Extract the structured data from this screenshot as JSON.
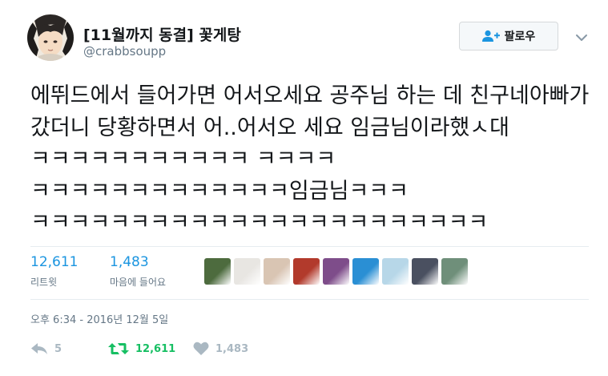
{
  "user": {
    "display_name": "[11월까지 동결] 꽃게탕",
    "handle": "@crabbsoupp",
    "avatar_icon": "anime-profile-avatar"
  },
  "follow_button": {
    "label": "팔로우",
    "icon": "add-user-icon"
  },
  "tweet": {
    "text": "에뛰드에서 들어가면 어서오세요 공주님 하는 데 친구네아빠가 갔더니 당황하면서 어..어서오 세요 임금님이라했ㅅ대 ㅋㅋㅋㅋㅋㅋㅋㅋㅋㅋㅋ ㅋㅋㅋㅋ ㅋㅋㅋㅋㅋㅋㅋㅋㅋㅋㅋㅋㅋ임금님ㅋㅋㅋ ㅋㅋㅋㅋㅋㅋㅋㅋㅋㅋㅋㅋㅋㅋㅋㅋㅋㅋㅋㅋㅋㅋㅋ"
  },
  "stats": {
    "retweets": {
      "count": "12,611",
      "label": "리트윗"
    },
    "likes": {
      "count": "1,483",
      "label": "마음에 들어요"
    }
  },
  "likers": [
    {
      "name": "liker-avatar-1",
      "color": "#4d6b3e"
    },
    {
      "name": "liker-avatar-2",
      "color": "#e8e6e2"
    },
    {
      "name": "liker-avatar-3",
      "color": "#d9c5b3"
    },
    {
      "name": "liker-avatar-4",
      "color": "#b23a2c"
    },
    {
      "name": "liker-avatar-5",
      "color": "#7e4d8a"
    },
    {
      "name": "liker-avatar-6",
      "color": "#2a8fd4"
    },
    {
      "name": "liker-avatar-7",
      "color": "#b7d7e8"
    },
    {
      "name": "liker-avatar-8",
      "color": "#4a5060"
    },
    {
      "name": "liker-avatar-9",
      "color": "#6f8f7a"
    }
  ],
  "timestamp": "오후 6:34 - 2016년 12월 5일",
  "actions": {
    "reply_count": "5",
    "retweet_count": "12,611",
    "like_count": "1,483"
  },
  "colors": {
    "accent": "#1b95e0",
    "retweet_green": "#17bf63",
    "muted": "#aab8c2",
    "secondary_text": "#657786"
  }
}
